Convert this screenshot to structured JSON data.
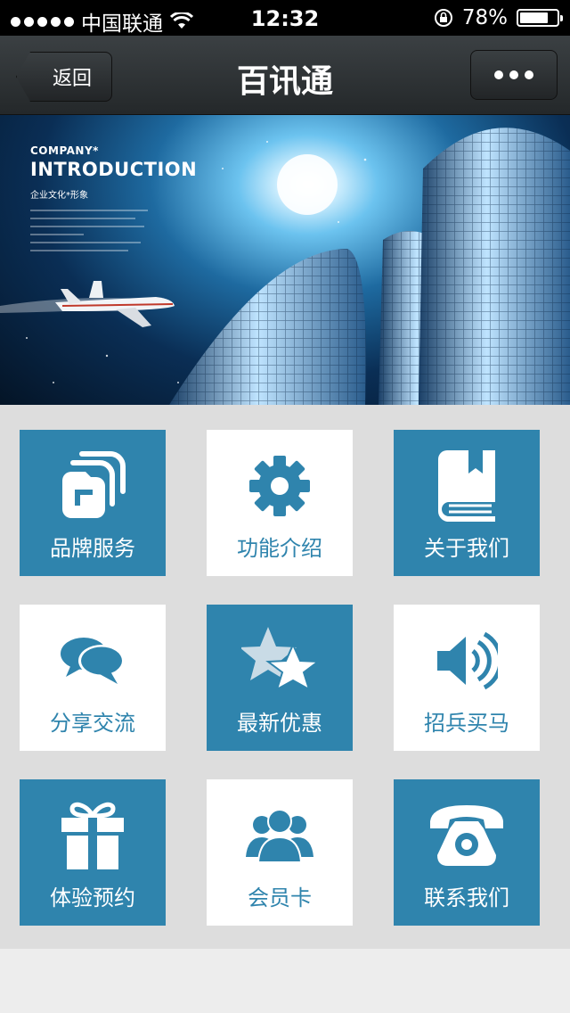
{
  "status_bar": {
    "carrier": "中国联通",
    "time": "12:32",
    "battery": "78%",
    "battery_level": 0.78
  },
  "nav": {
    "back_label": "返回",
    "title": "百讯通"
  },
  "banner": {
    "small_text": "COMPANY*",
    "title": "INTRODUCTION",
    "subtitle": "企业文化*形象"
  },
  "tiles": [
    {
      "label": "品牌服务",
      "icon": "folder-icon",
      "style": "blue"
    },
    {
      "label": "功能介绍",
      "icon": "gear-icon",
      "style": "white"
    },
    {
      "label": "关于我们",
      "icon": "book-icon",
      "style": "blue"
    },
    {
      "label": "分享交流",
      "icon": "chat-bubbles-icon",
      "style": "white"
    },
    {
      "label": "最新优惠",
      "icon": "stars-icon",
      "style": "blue"
    },
    {
      "label": "招兵买马",
      "icon": "speaker-icon",
      "style": "white"
    },
    {
      "label": "体验预约",
      "icon": "gift-icon",
      "style": "blue"
    },
    {
      "label": "会员卡",
      "icon": "members-icon",
      "style": "white"
    },
    {
      "label": "联系我们",
      "icon": "telephone-icon",
      "style": "blue"
    }
  ],
  "colors": {
    "tile_blue": "#2f84ad",
    "tile_white": "#ffffff",
    "nav_bg": "#2c3033"
  }
}
